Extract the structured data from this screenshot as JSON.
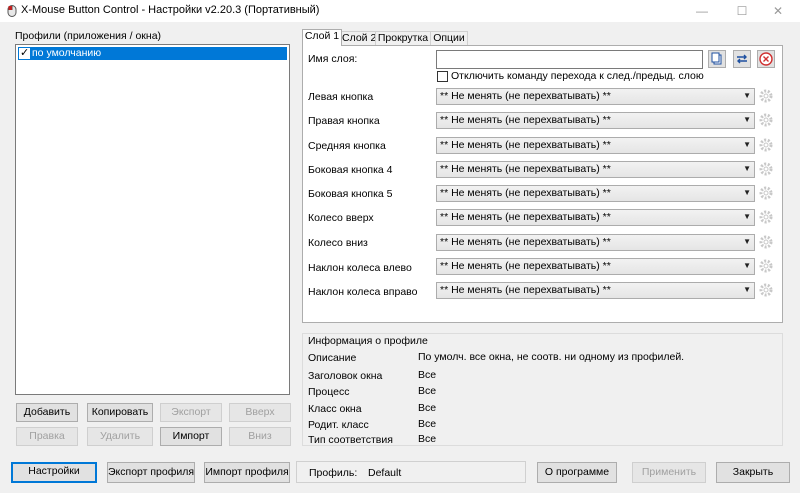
{
  "window": {
    "title": "X-Mouse Button Control - Настройки v2.20.3 (Портативный)",
    "controls": [
      "—",
      "☐",
      "✕"
    ]
  },
  "profiles": {
    "group_label": "Профили (приложения / окна)",
    "items": [
      {
        "label": "по умолчанию",
        "checked": true
      }
    ],
    "buttons": {
      "add": "Добавить",
      "copy": "Копировать",
      "export": "Экспорт",
      "up": "Вверх",
      "edit": "Правка",
      "delete": "Удалить",
      "import": "Импорт",
      "down": "Вниз"
    }
  },
  "tabs": [
    "Слой 1",
    "Слой 2",
    "Прокрутка",
    "Опции"
  ],
  "layer": {
    "name_label": "Имя слоя:",
    "name_value": "",
    "disable_switch_label": "Отключить команду перехода к след./предыд. слою",
    "buttons": [
      {
        "label": "Левая кнопка",
        "value": "** Не менять (не перехватывать) **"
      },
      {
        "label": "Правая кнопка",
        "value": "** Не менять (не перехватывать) **"
      },
      {
        "label": "Средняя кнопка",
        "value": "** Не менять (не перехватывать) **"
      },
      {
        "label": "Боковая кнопка 4",
        "value": "** Не менять (не перехватывать) **"
      },
      {
        "label": "Боковая кнопка 5",
        "value": "** Не менять (не перехватывать) **"
      },
      {
        "label": "Колесо вверх",
        "value": "** Не менять (не перехватывать) **"
      },
      {
        "label": "Колесо вниз",
        "value": "** Не менять (не перехватывать) **"
      },
      {
        "label": "Наклон колеса влево",
        "value": "** Не менять (не перехватывать) **"
      },
      {
        "label": "Наклон колеса вправо",
        "value": "** Не менять (не перехватывать) **"
      }
    ]
  },
  "profile_info": {
    "group_label": "Информация о профиле",
    "rows": [
      {
        "key": "Описание",
        "value": "По умолч. все окна, не соотв. ни одному из профилей."
      },
      {
        "key": "Заголовок окна",
        "value": "Все"
      },
      {
        "key": "Процесс",
        "value": "Все"
      },
      {
        "key": "Класс окна",
        "value": "Все"
      },
      {
        "key": "Родит. класс",
        "value": "Все"
      },
      {
        "key": "Тип соответствия",
        "value": "Все"
      }
    ]
  },
  "footer": {
    "settings": "Настройки",
    "export_profile": "Экспорт профиля",
    "import_profile": "Импорт профиля",
    "profile_label": "Профиль:",
    "profile_value": "Default",
    "about": "О программе",
    "apply": "Применить",
    "close": "Закрыть"
  },
  "colors": {
    "accent": "#0078d7",
    "window_bg": "#f0f0f0",
    "disabled_text": "#a0a0a0"
  }
}
